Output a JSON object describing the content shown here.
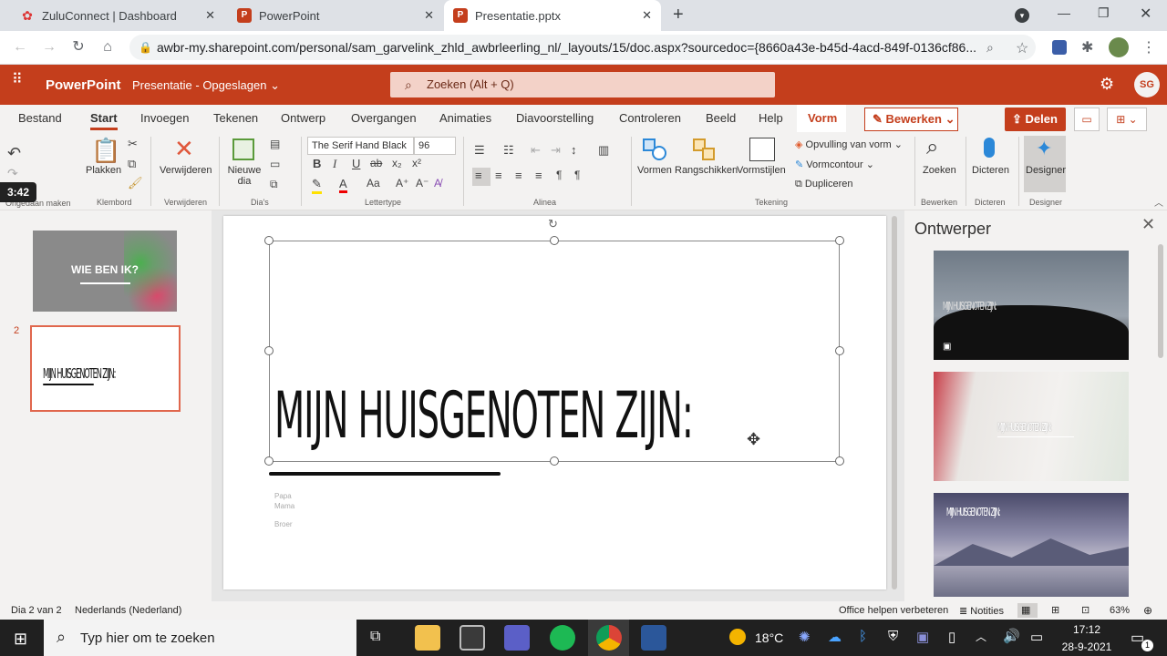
{
  "browser": {
    "tabs": [
      {
        "title": "ZuluConnect | Dashboard"
      },
      {
        "title": "PowerPoint"
      },
      {
        "title": "Presentatie.pptx"
      }
    ],
    "url": "awbr-my.sharepoint.com/personal/sam_garvelink_zhld_awbrleerling_nl/_layouts/15/doc.aspx?sourcedoc={8660a43e-b45d-4acd-849f-0136cf86..."
  },
  "app": {
    "name": "PowerPoint",
    "doc_title": "Presentatie - Opgeslagen",
    "search_placeholder": "Zoeken (Alt + Q)",
    "avatar": "SG",
    "edit_label": "Bewerken",
    "share_label": "Delen"
  },
  "ribbon": {
    "tabs": [
      "Bestand",
      "Start",
      "Invoegen",
      "Tekenen",
      "Ontwerp",
      "Overgangen",
      "Animaties",
      "Diavoorstelling",
      "Controleren",
      "Beeld",
      "Help",
      "Vorm"
    ],
    "undo_label": "Ongedaan maken",
    "timer": "3:42",
    "paste_label": "Plakken",
    "clipboard_group": "Klembord",
    "delete_label": "Verwijderen",
    "delete_group": "Verwijderen",
    "new_slide_label": "Nieuwe dia",
    "slides_group": "Dia's",
    "font_name": "The Serif Hand Black",
    "font_size": "96",
    "font_group": "Lettertype",
    "paragraph_group": "Alinea",
    "shapes_label": "Vormen",
    "arrange_label": "Rangschikken",
    "styles_label": "Vormstijlen",
    "fill_label": "Opvulling van vorm",
    "outline_label": "Vormcontour",
    "duplicate_label": "Dupliceren",
    "drawing_group": "Tekening",
    "find_label": "Zoeken",
    "editing_group": "Bewerken",
    "dictate_label": "Dicteren",
    "dictate_group": "Dicteren",
    "designer_label": "Designer",
    "designer_group": "Designer"
  },
  "slides": [
    {
      "number": "",
      "title": "WIE BEN IK?"
    },
    {
      "number": "2",
      "title": "MIJN HUISGENOTEN ZIJN:"
    }
  ],
  "slide": {
    "title": "MIJN HUISGENOTEN ZIJN:",
    "bullets": [
      "Papa",
      "Mama",
      "Broer"
    ]
  },
  "designer_panel": {
    "title": "Ontwerper",
    "ideas": [
      "MIJN HUISGENOTEN ZIJN:",
      "MIJN HUISGENOTEN ZIJN:",
      "MIJN HUISGENOTEN ZIJN:"
    ]
  },
  "status": {
    "slide_info": "Dia 2 van 2",
    "language": "Nederlands (Nederland)",
    "feedback": "Office helpen verbeteren",
    "notes": "Notities",
    "zoom": "63%"
  },
  "taskbar": {
    "search_placeholder": "Typ hier om te zoeken",
    "temperature": "18°C",
    "time": "17:12",
    "date": "28-9-2021",
    "notifications": "1"
  }
}
